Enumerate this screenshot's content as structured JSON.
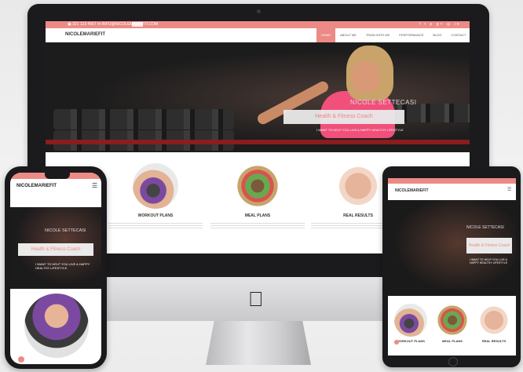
{
  "desktop": {
    "topbar_info": "▣ 321 123 4567  ✉ INFO@NICOLEMARIEFIT.COM",
    "topbar_socials": "f t p g+ ◎ in",
    "brand": "NICOLEMARIEFIT",
    "nav": [
      "HOME",
      "ABOUT ME",
      "TRAIN WITH ME",
      "PERFORMANCE",
      "BLOG",
      "CONTACT"
    ],
    "hero": {
      "name": "NICOLE SETTECASI",
      "title": "Health & Fitness Coach",
      "tagline": "I WANT TO HELP YOU LIVE A HAPPY HEALTHY LIFESTYLE"
    },
    "services": [
      {
        "label": "WORKOUT PLANS"
      },
      {
        "label": "MEAL PLANS"
      },
      {
        "label": "REAL RESULTS"
      }
    ]
  },
  "phone": {
    "brand": "NICOLEMARIEFIT",
    "menu_icon": "☰",
    "hero": {
      "name": "NICOLE SETTECASI",
      "title": "Health & Fitness Coach",
      "tagline": "I WANT TO HELP YOU LIVE A HAPPY HEALTHY LIFESTYLE"
    }
  },
  "tablet": {
    "brand": "NICOLEMARIEFIT",
    "menu_icon": "☰",
    "hero": {
      "name": "NICOLE SETTECASI",
      "title": "Health & Fitness Coach",
      "tagline": "I WANT TO HELP YOU LIVE A HAPPY HEALTHY LIFESTYLE"
    },
    "services": [
      {
        "label": "WORKOUT PLANS"
      },
      {
        "label": "MEAL PLANS"
      },
      {
        "label": "REAL RESULTS"
      }
    ]
  },
  "colors": {
    "accent": "#ec8a86",
    "hero_pink": "#f0507a"
  },
  "icons": [
    "apple-logo-icon",
    "menu-icon",
    "camera-icon"
  ]
}
